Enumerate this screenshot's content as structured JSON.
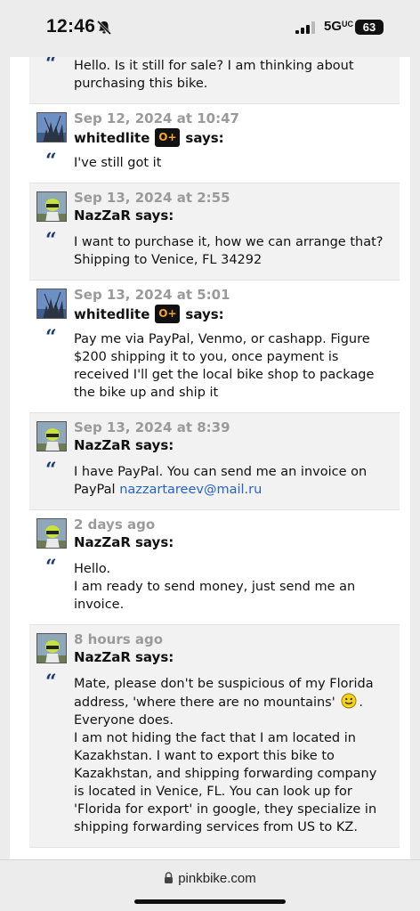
{
  "status_bar": {
    "time": "12:46",
    "network": "5G",
    "network_suffix": "UC",
    "battery": "63"
  },
  "comments": [
    {
      "body": [
        "Hello. Is it still for sale? I am thinking about purchasing this bike."
      ]
    },
    {
      "date": "Sep 12, 2024 at 10:47",
      "author": "whitedlite",
      "plus_badge": "O+",
      "says": "says:",
      "body": [
        "I've still got it"
      ]
    },
    {
      "date": "Sep 13, 2024 at 2:55",
      "author": "NazZaR",
      "says": "says:",
      "body": [
        "I want to purchase it, how we can arrange that?",
        "Shipping to Venice, FL 34292"
      ]
    },
    {
      "date": "Sep 13, 2024 at 5:01",
      "author": "whitedlite",
      "plus_badge": "O+",
      "says": "says:",
      "body": [
        "Pay me via PayPal, Venmo, or cashapp. Figure $200 shipping it to you, once payment is received I'll get the local bike shop to package the bike up and ship it"
      ]
    },
    {
      "date": "Sep 13, 2024 at 8:39",
      "author": "NazZaR",
      "says": "says:",
      "body_prefix": "I have PayPal. You can send me an invoice on PayPal ",
      "email": "nazzartareev@mail.ru"
    },
    {
      "date": "2 days ago",
      "author": "NazZaR",
      "says": "says:",
      "body": [
        "Hello.",
        "I am ready to send money, just send me an invoice."
      ]
    },
    {
      "date": "8 hours ago",
      "author": "NazZaR",
      "says": "says:",
      "body_part1": "Mate, please don't be suspicious of my Florida address, 'where there are no mountains'",
      "body_part2": ". Everyone does.",
      "body_more": "I am not hiding the fact that I am located in Kazakhstan. I want to export this bike to Kazakhstan, and shipping forwarding company is located in Venice, FL. You can look up for 'Florida for export' in google, they specialize in shipping forwarding services from US to KZ."
    }
  ],
  "quote_mark": "“",
  "url_bar": {
    "domain": "pinkbike.com"
  }
}
